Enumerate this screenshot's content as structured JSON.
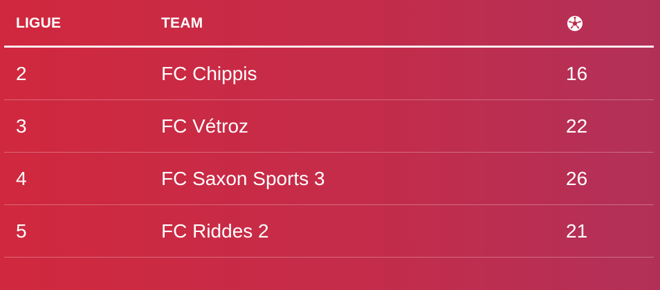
{
  "table": {
    "headers": {
      "league": "LIGUE",
      "team": "TEAM",
      "goals_icon": "soccer-ball-icon"
    },
    "rows": [
      {
        "league": "2",
        "team": "FC Chippis",
        "goals": "16"
      },
      {
        "league": "3",
        "team": "FC Vétroz",
        "goals": "22"
      },
      {
        "league": "4",
        "team": "FC Saxon Sports 3",
        "goals": "26"
      },
      {
        "league": "5",
        "team": "FC Riddes 2",
        "goals": "21"
      }
    ]
  },
  "colors": {
    "background_start": "#d0283e",
    "background_end": "#b23058",
    "text": "#ffffff"
  }
}
